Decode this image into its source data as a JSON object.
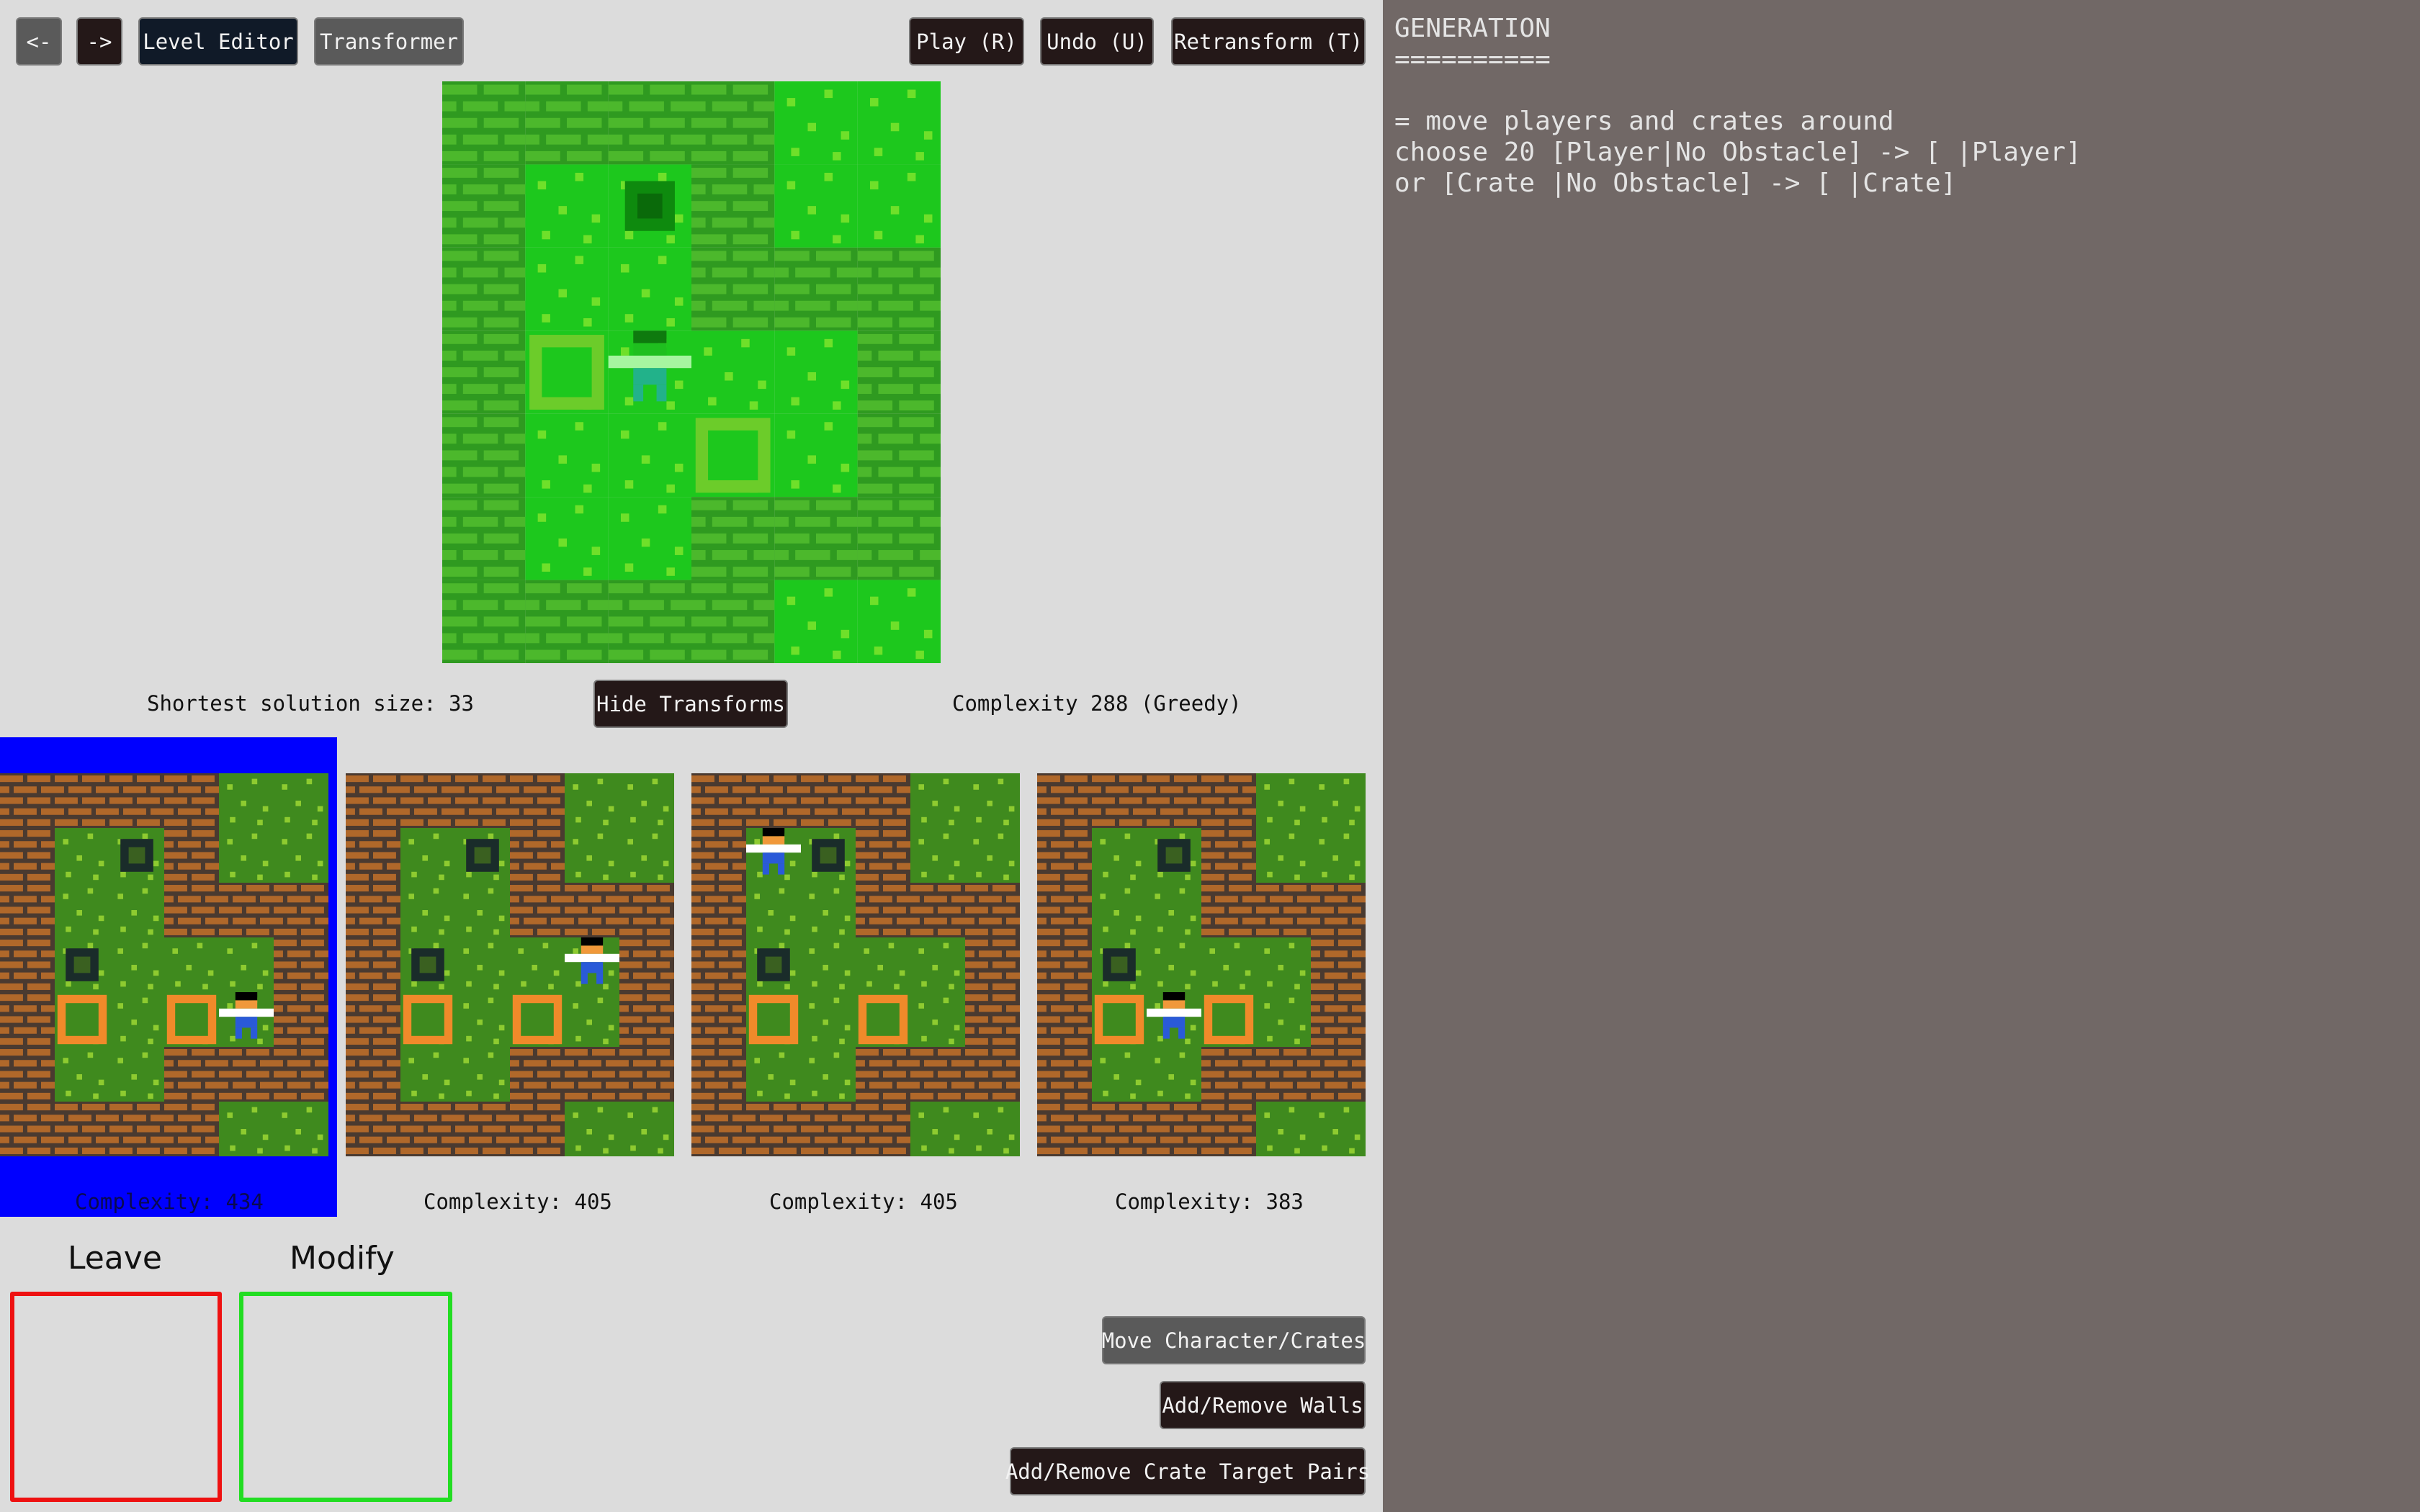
{
  "toolbar": {
    "back_label": "<-",
    "forward_label": "->",
    "level_editor_label": "Level Editor",
    "transformer_label": "Transformer",
    "play_label": "Play (R)",
    "undo_label": "Undo (U)",
    "retransform_label": "Retransform (T)"
  },
  "stats": {
    "shortest_solution": "Shortest solution size: 33",
    "hide_transforms_label": "Hide Transforms",
    "complexity": "Complexity 288 (Greedy)"
  },
  "transforms": [
    {
      "label": "Complexity: 434",
      "selected": true
    },
    {
      "label": "Complexity: 405",
      "selected": false
    },
    {
      "label": "Complexity: 405",
      "selected": false
    },
    {
      "label": "Complexity: 383",
      "selected": false
    }
  ],
  "zones": {
    "leave_label": "Leave",
    "modify_label": "Modify",
    "leave_color": "#ee1111",
    "modify_color": "#22dd22"
  },
  "tools": {
    "move_label": "Move Character/Crates",
    "walls_label": "Add/Remove Walls",
    "targets_label": "Add/Remove Crate Target Pairs"
  },
  "panel": {
    "text": "GENERATION\n==========\n\n= move players and crates around\nchoose 20 [Player|No Obstacle] -> [ |Player]\nor [Crate |No Obstacle] -> [ |Crate]"
  },
  "colors": {
    "selection": "#0000ff",
    "panel_bg": "#716866",
    "page_bg": "#dcdcdc"
  }
}
